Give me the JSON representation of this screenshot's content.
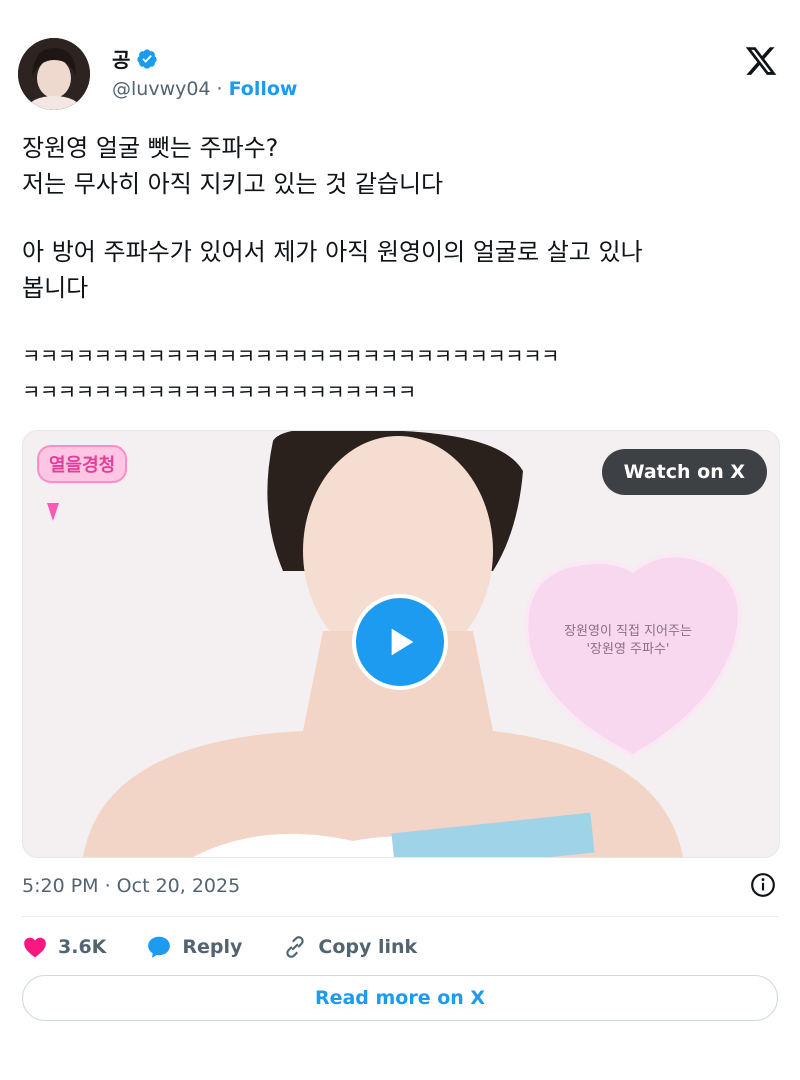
{
  "author": {
    "name": "공",
    "handle": "@luvwy04",
    "separator": "·",
    "follow_label": "Follow",
    "verified": true
  },
  "tweet": {
    "line1": "장원영 얼굴 뺏는 주파수?",
    "line2": "저는 무사히 아직 지키고 있는 것 같습니다",
    "line3": "아 방어 주파수가 있어서 제가 아직 원영이의 얼굴로 살고 있나",
    "line4": "봅니다",
    "line5": "ㅋㅋㅋㅋㅋㅋㅋㅋㅋㅋㅋㅋㅋㅋㅋㅋㅋㅋㅋㅋㅋㅋㅋㅋㅋㅋㅋㅋㅋㅋ",
    "line6": "ㅋㅋㅋㅋㅋㅋㅋㅋㅋㅋㅋㅋㅋㅋㅋㅋㅋㅋㅋㅋㅋㅋ"
  },
  "media": {
    "watch_label": "Watch on X",
    "heart_caption_1": "장원영이 직접 지어주는",
    "heart_caption_2": "'장원영 주파수'",
    "sticker_text": "열을경청"
  },
  "meta": {
    "timestamp": "5:20 PM · Oct 20, 2025"
  },
  "actions": {
    "likes": "3.6K",
    "reply_label": "Reply",
    "copy_label": "Copy link"
  },
  "read_more_label": "Read more on X",
  "colors": {
    "accent": "#1d9bf0",
    "like": "#f91880",
    "text": "#0f1419",
    "muted": "#536471"
  }
}
